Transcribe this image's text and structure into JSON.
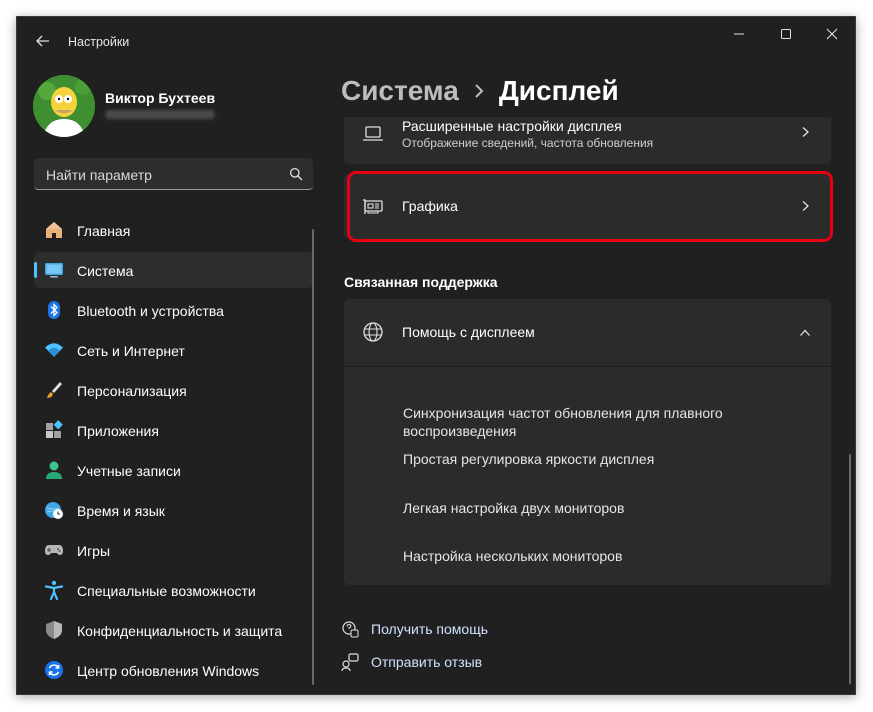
{
  "titlebar": {
    "app_title": "Настройки",
    "back_icon": "arrow-left-icon",
    "controls": [
      "minimize-icon",
      "maximize-icon",
      "close-icon"
    ]
  },
  "profile": {
    "name": "Виктор Бухтеев",
    "avatar_icon": "user-avatar"
  },
  "search": {
    "placeholder": "Найти параметр",
    "value": "",
    "icon": "search-icon"
  },
  "sidebar": {
    "items": [
      {
        "label": "Главная",
        "icon": "home-icon",
        "active": false
      },
      {
        "label": "Система",
        "icon": "monitor-icon",
        "active": true
      },
      {
        "label": "Bluetooth и устройства",
        "icon": "bluetooth-icon",
        "active": false
      },
      {
        "label": "Сеть и Интернет",
        "icon": "wifi-icon",
        "active": false
      },
      {
        "label": "Персонализация",
        "icon": "brush-icon",
        "active": false
      },
      {
        "label": "Приложения",
        "icon": "apps-icon",
        "active": false
      },
      {
        "label": "Учетные записи",
        "icon": "account-icon",
        "active": false
      },
      {
        "label": "Время и язык",
        "icon": "globe-clock-icon",
        "active": false
      },
      {
        "label": "Игры",
        "icon": "gamepad-icon",
        "active": false
      },
      {
        "label": "Специальные возможности",
        "icon": "accessibility-icon",
        "active": false
      },
      {
        "label": "Конфиденциальность и защита",
        "icon": "shield-icon",
        "active": false
      },
      {
        "label": "Центр обновления Windows",
        "icon": "update-icon",
        "active": false
      }
    ]
  },
  "main": {
    "breadcrumb": {
      "parent": "Система",
      "current": "Дисплей"
    },
    "advanced_display": {
      "title": "Расширенные настройки дисплея",
      "subtitle": "Отображение сведений, частота обновления"
    },
    "graphics": {
      "title": "Графика"
    },
    "related_support": {
      "title": "Связанная поддержка",
      "help": {
        "title": "Помощь с дисплеем",
        "links": [
          "Синхронизация частот обновления для плавного воспроизведения",
          "Простая регулировка яркости дисплея",
          "Легкая настройка двух мониторов",
          "Настройка нескольких мониторов"
        ]
      }
    },
    "footer": {
      "get_help": "Получить помощь",
      "feedback": "Отправить отзыв"
    }
  },
  "colors": {
    "accent": "#4cc2ff",
    "highlight_border": "#e60012",
    "window_bg": "#202020",
    "card_bg": "#2b2b2b"
  }
}
